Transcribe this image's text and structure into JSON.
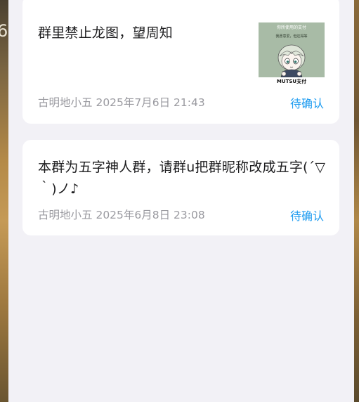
{
  "background": {
    "left_glyph": "6"
  },
  "announcements": [
    {
      "text": "群里禁止龙图，望周知",
      "author": "古明地小五",
      "datetime": "2025年7月6日 21:43",
      "status": "待确认",
      "thumbnail": {
        "top_text": "你所使用的支付",
        "mid_text": "我愿意爱，但还得等",
        "caption": "MUTSU支付"
      }
    },
    {
      "text": "本群为五字神人群，请群u把群昵称改成五字(´▽｀)ノ♪",
      "author": "古明地小五",
      "datetime": "2025年6月8日 23:08",
      "status": "待确认"
    }
  ],
  "colors": {
    "status": "#1c9bf0",
    "panel_bg": "#f2f1f6",
    "thumbnail_bg": "#a8bba6"
  }
}
